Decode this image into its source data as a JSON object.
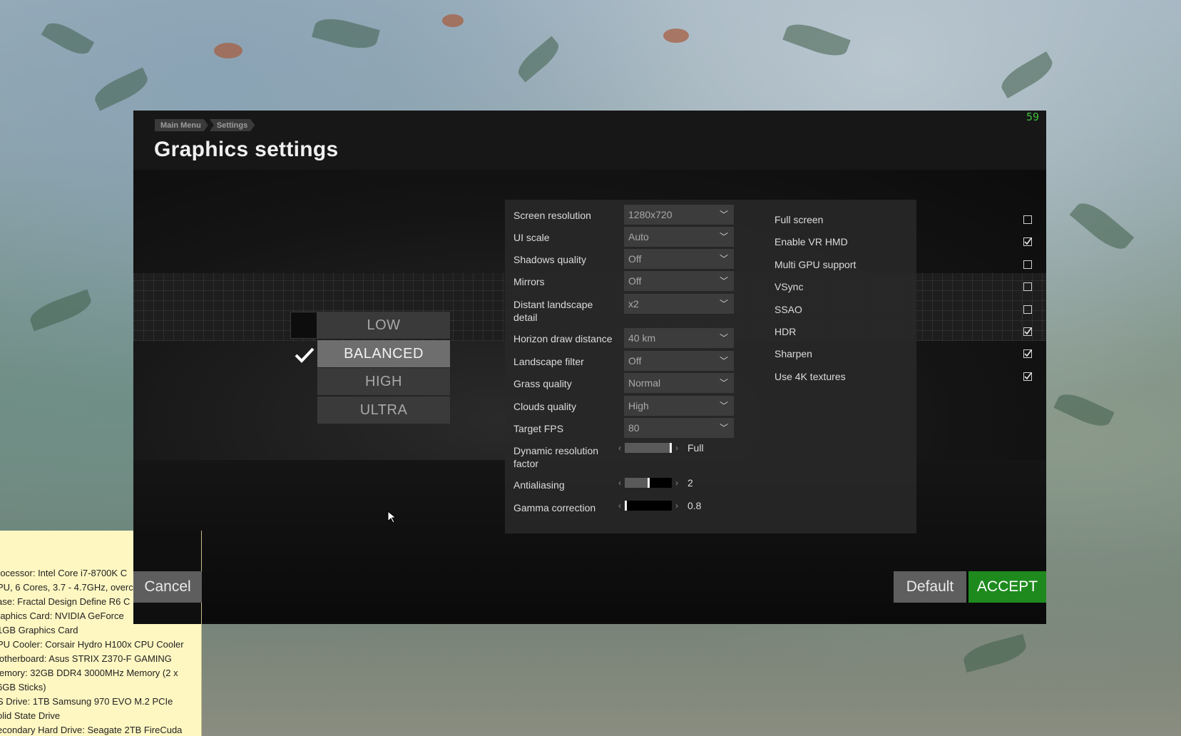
{
  "dialog": {
    "fps": "59",
    "breadcrumb": [
      "Main Menu",
      "Settings"
    ],
    "title": "Graphics settings"
  },
  "presets": {
    "items": [
      "LOW",
      "BALANCED",
      "HIGH",
      "ULTRA"
    ],
    "selected": "BALANCED"
  },
  "settings": {
    "dropdowns": [
      {
        "label": "Screen resolution",
        "value": "1280x720"
      },
      {
        "label": "UI scale",
        "value": "Auto"
      },
      {
        "label": "Shadows quality",
        "value": "Off"
      },
      {
        "label": "Mirrors",
        "value": "Off"
      },
      {
        "label": "Distant landscape detail",
        "value": "x2"
      },
      {
        "label": "Horizon draw distance",
        "value": "40 km"
      },
      {
        "label": "Landscape filter",
        "value": "Off"
      },
      {
        "label": "Grass quality",
        "value": "Normal"
      },
      {
        "label": "Clouds quality",
        "value": "High"
      },
      {
        "label": "Target FPS",
        "value": "80"
      }
    ],
    "sliders": [
      {
        "label": "Dynamic resolution factor",
        "value": "Full",
        "level": 1.0
      },
      {
        "label": "Antialiasing",
        "value": "2",
        "level": 0.5
      },
      {
        "label": "Gamma correction",
        "value": "0.8",
        "level": 0.0
      }
    ],
    "checkboxes": [
      {
        "label": "Full screen",
        "checked": false
      },
      {
        "label": "Enable VR HMD",
        "checked": true
      },
      {
        "label": "Multi GPU support",
        "checked": false
      },
      {
        "label": "VSync",
        "checked": false
      },
      {
        "label": "SSAO",
        "checked": false
      },
      {
        "label": "HDR",
        "checked": true
      },
      {
        "label": "Sharpen",
        "checked": true
      },
      {
        "label": "Use 4K textures",
        "checked": true
      }
    ]
  },
  "buttons": {
    "cancel": "Cancel",
    "default": "Default",
    "accept": "ACCEPT"
  },
  "specs": [
    "rocessor: Intel Core i7-8700K C",
    "PU, 6 Cores, 3.7 - 4.7GHz, overc",
    "ase: Fractal Design Define R6 C",
    "raphics Card: NVIDIA GeForce",
    "1GB Graphics Card",
    "PU Cooler: Corsair Hydro H100x CPU Cooler",
    "lotherboard: Asus STRIX Z370-F GAMING",
    "lemory: 32GB DDR4 3000MHz Memory (2 x",
    "6GB Sticks)",
    "S Drive: 1TB Samsung 970 EVO M.2 PCIe",
    "olid State Drive",
    "econdary Hard Drive: Seagate 2TB FireCuda"
  ],
  "colors": {
    "accept": "#1e8a1e",
    "fps": "#3fbf3f",
    "specs_bg": "#fff7c2"
  }
}
